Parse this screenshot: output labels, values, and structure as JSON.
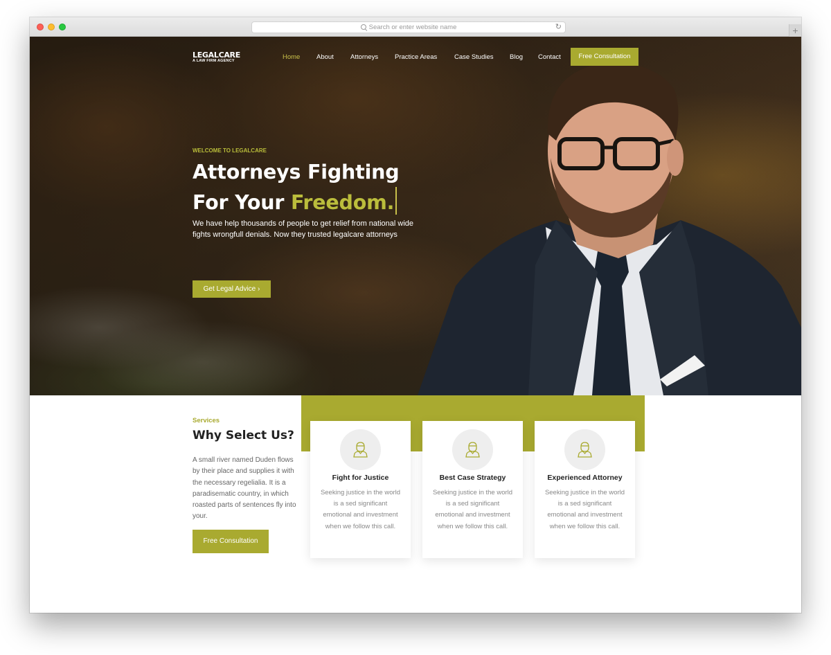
{
  "browser": {
    "url_placeholder": "Search or enter website name"
  },
  "nav": {
    "logo_title": "LEGALCARE",
    "logo_subtitle": "A LAW FIRM AGENCY",
    "links": [
      "Home",
      "About",
      "Attorneys",
      "Practice Areas",
      "Case Studies",
      "Blog",
      "Contact"
    ],
    "active": "Home",
    "cta": "Free Consultation"
  },
  "hero": {
    "eyebrow": "WELCOME TO LEGALCARE",
    "headline_line1": "Attorneys Fighting",
    "headline_line2": "For Your",
    "headline_highlight": "Freedom.",
    "description": "We have help thousands of people to get relief from national wide fights wrongfull denials. Now they trusted legalcare attorneys",
    "button": "Get Legal Advice ›"
  },
  "services": {
    "eyebrow": "Services",
    "title": "Why Select Us?",
    "description": "A small river named Duden flows by their place and supplies it with the necessary regelialia. It is a paradisematic country, in which roasted parts of sentences fly into your.",
    "button": "Free Consultation",
    "cards": [
      {
        "title": "Fight for Justice",
        "text": "Seeking justice in the world is a sed significant emotional and investment when we follow this call.",
        "icon": "lawyer-icon"
      },
      {
        "title": "Best Case Strategy",
        "text": "Seeking justice in the world is a sed significant emotional and investment when we follow this call.",
        "icon": "lawyer-icon"
      },
      {
        "title": "Experienced Attorney",
        "text": "Seeking justice in the world is a sed significant emotional and investment when we follow this call.",
        "icon": "lawyer-icon"
      }
    ]
  },
  "colors": {
    "accent": "#a9aa30",
    "highlight": "#bbbd3c"
  }
}
